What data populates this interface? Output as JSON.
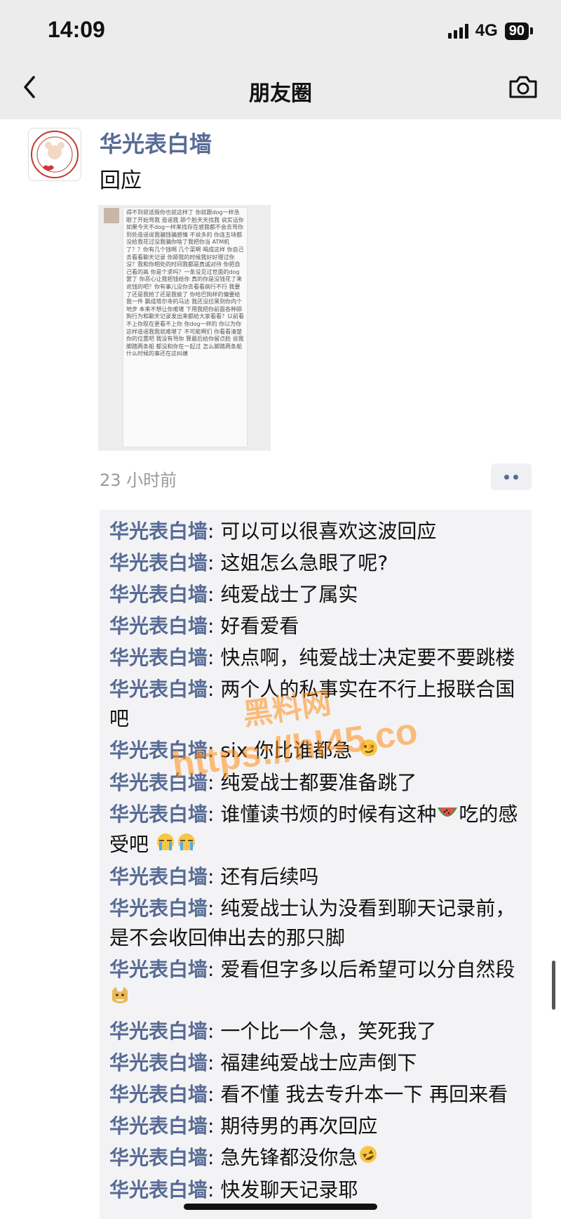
{
  "status_bar": {
    "time": "14:09",
    "network": "4G",
    "battery": "90"
  },
  "nav": {
    "title": "朋友圈"
  },
  "post": {
    "author": "华光表白墙",
    "text": "回应",
    "image_text": "得不到就诋毁你也就这样了 你就跟dog一样急眼了开始骂我 造谣我 舔个脸天天找我 说实话你如果今天不dog一样来找存在感我都不会去骂你 到处造谣说我骗钱骗感情 不说多的 你连五块都没给我花过没我骗你啥了我把你当 ATM机了？？你有几个钱啊 几个菜啊 喝成这样 你自己去看看聊天记录 你舔我的时候我好好理过你没？我和你相处的时间我都是真诚对待 你把自己看的高 你是个求吗？一条没见过世面的dog罢了 你恶心让我把钱给你 真的你是没钱花了来讹钱的吧？你有事儿没你去看看病行不行 我要了还是我抢了还是我偷了 你哈巴狗样的偏要给我一件 飘成塔尔寺的马达 我还没拉黑到你内个地步 本来不想让你难堪 下用我把你前面各种舔狗行为和聊天记录发出来都给大家看看？以前看不上你现在更看不上你 你dog一样的 你以为你这样造谣我我就难堪了 不可能啊们 你看看清楚你的位置吧 我没有骂你 算最后给你留点脸 说我脚踏两条船 都没和你在一起过 怎么脚踏两条船 什么时候的事还在这纠缠",
    "time_ago": "23 小时前",
    "comments": [
      {
        "name": "华光表白墙",
        "sep": ": ",
        "text": "可以可以很喜欢这波回应"
      },
      {
        "name": "华光表白墙",
        "sep": ": ",
        "text": "这姐怎么急眼了呢?"
      },
      {
        "name": "华光表白墙",
        "sep": ": ",
        "text": "纯爱战士了属实"
      },
      {
        "name": "华光表白墙",
        "sep": ": ",
        "text": "好看爱看"
      },
      {
        "name": "华光表白墙",
        "sep": ": ",
        "text": "快点啊，纯爱战士决定要不要跳楼"
      },
      {
        "name": "华光表白墙",
        "sep": ": ",
        "text": "两个人的私事实在不行上报联合国吧"
      },
      {
        "name": "华光表白墙",
        "sep": ": ",
        "text": "six 你比谁都急"
      },
      {
        "name": "华光表白墙",
        "sep": ": ",
        "text": "纯爱战士都要准备跳了"
      },
      {
        "name": "华光表白墙",
        "sep": ": ",
        "text": "谁懂读书烦的时候有这种",
        "text2": "吃的感受吧"
      },
      {
        "name": "华光表白墙",
        "sep": ": ",
        "text": "还有后续吗"
      },
      {
        "name": "华光表白墙",
        "sep": ": ",
        "text": "纯爱战士认为没看到聊天记录前，是不会收回伸出去的那只脚"
      },
      {
        "name": "华光表白墙",
        "sep": ": ",
        "text": "爱看但字多以后希望可以分自然段"
      },
      {
        "name": "华光表白墙",
        "sep": ": ",
        "text": "一个比一个急，笑死我了"
      },
      {
        "name": "华光表白墙",
        "sep": ": ",
        "text": "福建纯爱战士应声倒下"
      },
      {
        "name": "华光表白墙",
        "sep": ": ",
        "text": "看不懂 我去专升本一下 再回来看"
      },
      {
        "name": "华光表白墙",
        "sep": ": ",
        "text": "期待男的再次回应"
      },
      {
        "name": "华光表白墙",
        "sep": ": ",
        "text": "急先锋都没你急"
      },
      {
        "name": "华光表白墙",
        "sep": ": ",
        "text": "快发聊天记录耶"
      }
    ]
  },
  "watermark": {
    "top": "黑料网",
    "url": "https://hl45.co"
  },
  "colors": {
    "link": "#576b95",
    "topbar": "#ececec",
    "comment_bg": "#f3f3f5"
  }
}
